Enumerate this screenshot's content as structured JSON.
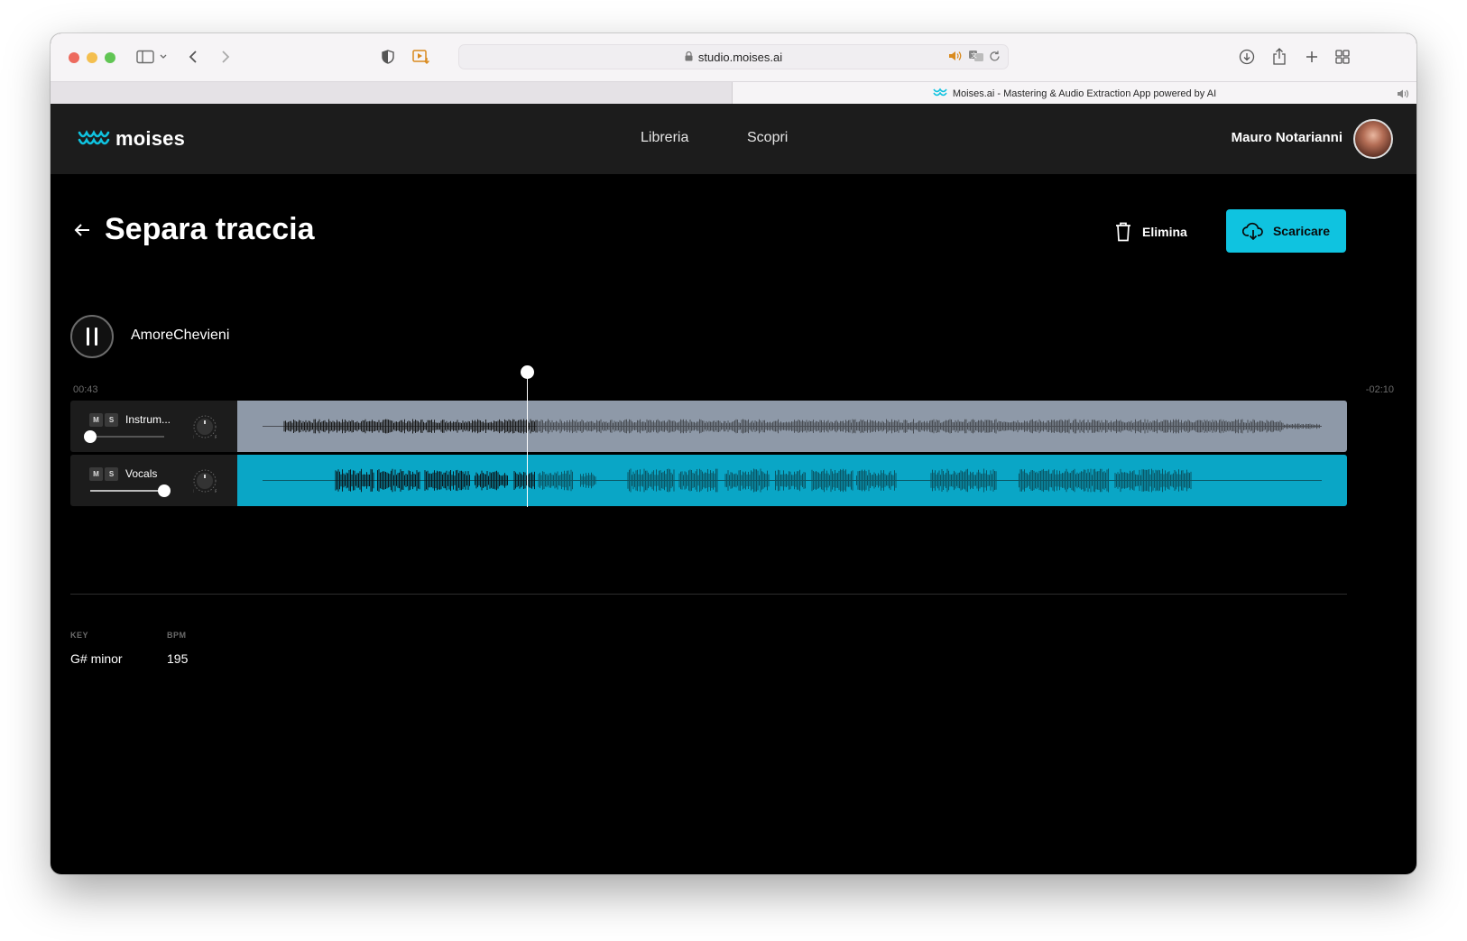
{
  "browser": {
    "url": "studio.moises.ai",
    "tab_title": "Moises.ai - Mastering & Audio Extraction App powered by AI"
  },
  "nav": {
    "logo_text": "moises",
    "links": [
      "Libreria",
      "Scopri"
    ],
    "user_name": "Mauro Notarianni"
  },
  "page": {
    "title": "Separa traccia",
    "delete_label": "Elimina",
    "download_label": "Scaricare"
  },
  "player": {
    "song_name": "AmoreChevieni",
    "time_elapsed": "00:43",
    "time_remaining": "-02:10",
    "playhead_progress": 0.25,
    "state": "playing"
  },
  "tracks": [
    {
      "name": "Instrum...",
      "mute_label": "M",
      "solo_label": "S",
      "volume": 0.0,
      "pan_left": "L",
      "pan_right": "R",
      "wave_color": "#8e99a8"
    },
    {
      "name": "Vocals",
      "mute_label": "M",
      "solo_label": "S",
      "volume": 1.0,
      "pan_left": "L",
      "pan_right": "R",
      "wave_color": "#0aa6c6"
    }
  ],
  "meta": {
    "key_label": "KEY",
    "key_value": "G# minor",
    "bpm_label": "BPM",
    "bpm_value": "195"
  },
  "colors": {
    "accent": "#0fc3e0",
    "background": "#000000",
    "header": "#1c1c1c"
  }
}
